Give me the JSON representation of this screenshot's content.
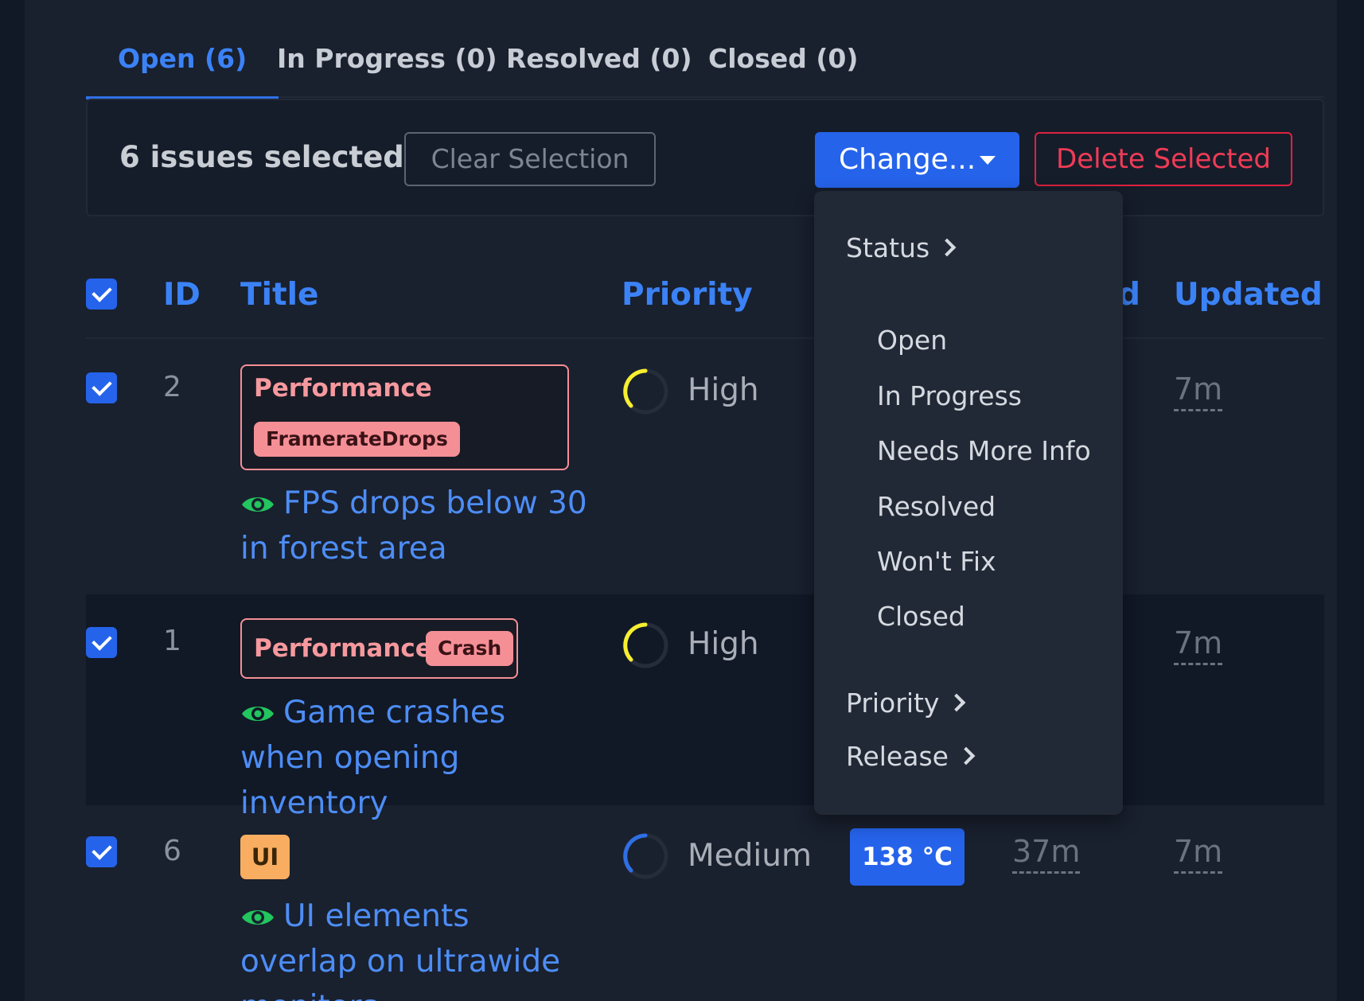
{
  "tabs": [
    {
      "label": "Open (6)",
      "active": true
    },
    {
      "label": "In Progress (0)",
      "active": false
    },
    {
      "label": "Resolved (0)",
      "active": false
    },
    {
      "label": "Closed (0)",
      "active": false
    }
  ],
  "bulk": {
    "selected_text": "6 issues selected",
    "clear_label": "Clear Selection",
    "change_label": "Change...",
    "delete_label": "Delete Selected"
  },
  "table": {
    "headers": {
      "id": "ID",
      "title": "Title",
      "priority": "Priority",
      "partial": "d",
      "updated": "Updated"
    },
    "rows": [
      {
        "id": "2",
        "category": "Performance",
        "tag": "FramerateDrops",
        "title": "FPS drops below 30 in forest area",
        "priority": "High",
        "updated": "7m"
      },
      {
        "id": "1",
        "category": "Performance",
        "tag": "Crash",
        "title": "Game crashes when opening inventory",
        "priority": "High",
        "updated": "7m"
      },
      {
        "id": "6",
        "category": "UI",
        "title": "UI elements overlap on ultrawide monitors",
        "priority": "Medium",
        "temperature": "138 °C",
        "created": "37m",
        "updated": "7m"
      }
    ]
  },
  "dropdown": {
    "status_label": "Status",
    "status_options": [
      "Open",
      "In Progress",
      "Needs More Info",
      "Resolved",
      "Won't Fix",
      "Closed"
    ],
    "priority_label": "Priority",
    "release_label": "Release"
  },
  "colors": {
    "accent": "#2563eb",
    "danger": "#e0213f",
    "tag_pink": "#f58f96",
    "ui_orange": "#f8ad60",
    "high_priority": "#f7ef2f",
    "medium_priority": "#2f6fe4"
  }
}
